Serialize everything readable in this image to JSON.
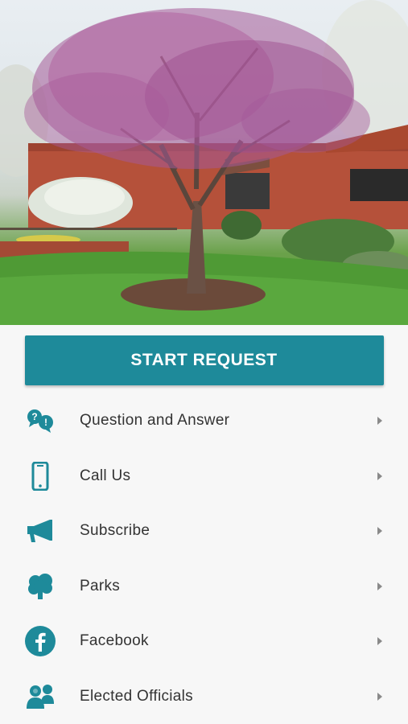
{
  "start_button": {
    "label": "START REQUEST"
  },
  "menu": {
    "items": [
      {
        "label": "Question and Answer",
        "icon": "question-answer-icon"
      },
      {
        "label": "Call Us",
        "icon": "phone-icon"
      },
      {
        "label": "Subscribe",
        "icon": "megaphone-icon"
      },
      {
        "label": "Parks",
        "icon": "tree-icon"
      },
      {
        "label": "Facebook",
        "icon": "facebook-icon"
      },
      {
        "label": "Elected Officials",
        "icon": "people-icon"
      }
    ]
  },
  "colors": {
    "accent": "#1e8a9a",
    "text": "#333333",
    "background": "#f7f7f7",
    "chevron": "#8a8a8a"
  }
}
